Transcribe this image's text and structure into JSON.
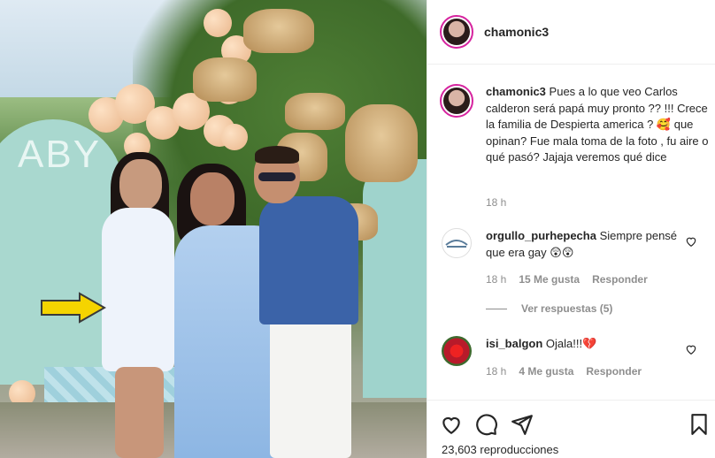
{
  "post": {
    "username": "chamonic3",
    "caption_user": "chamonic3",
    "caption_text": "Pues a lo que veo Carlos calderon será papá muy pronto ?? !!! Crece la familia de Despierta america ? 🥰 que opinan? Fue mala toma de la foto , fu aire o qué pasó? Jajaja veremos qué dice",
    "caption_time": "18 h",
    "photo_text": "ABY"
  },
  "comments": [
    {
      "user": "orgullo_purhepecha",
      "text": "Siempre pensé que era gay 😲😲",
      "time": "18 h",
      "likes": "15 Me gusta",
      "reply": "Responder",
      "view_replies": "Ver respuestas (5)"
    },
    {
      "user": "isi_balgon",
      "text": "Ojala!!!💔",
      "time": "18 h",
      "likes": "4 Me gusta",
      "reply": "Responder"
    }
  ],
  "footer": {
    "views": "23,603 reproducciones"
  },
  "icons": {
    "like": "heart-icon",
    "comment": "comment-icon",
    "share": "share-icon",
    "save": "bookmark-icon"
  }
}
